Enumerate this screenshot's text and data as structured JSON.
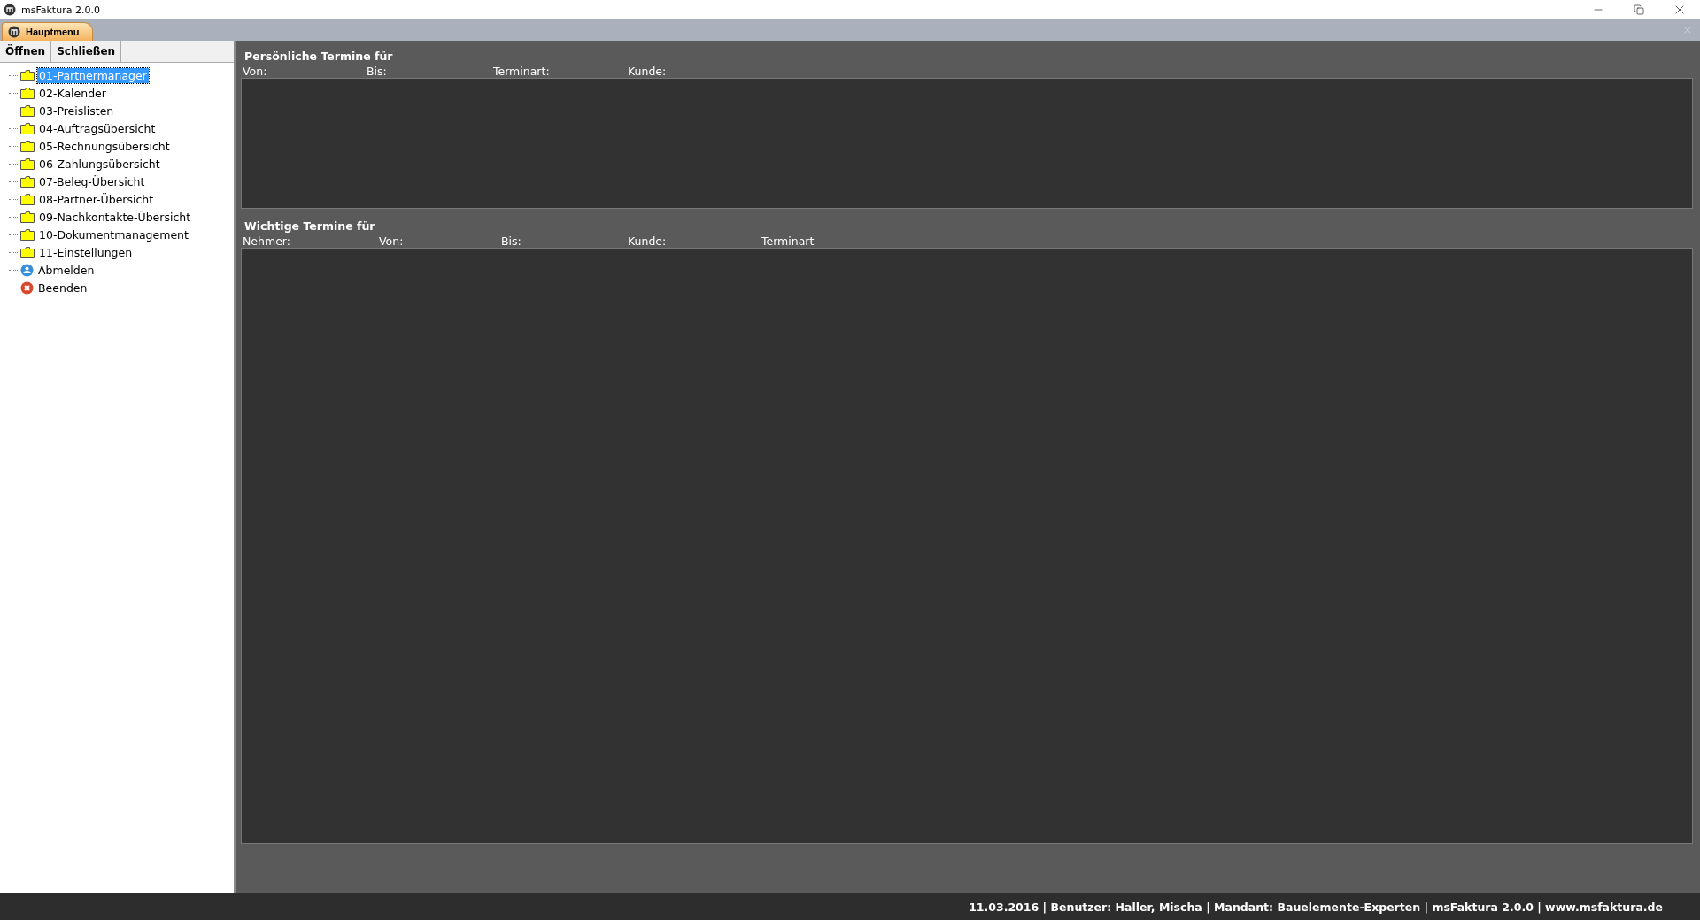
{
  "window": {
    "title": "msFaktura 2.0.0"
  },
  "tabs": [
    {
      "label": "Hauptmenu",
      "selected": true
    }
  ],
  "toolbar": [
    "Öffnen",
    "Schließen"
  ],
  "tree": [
    {
      "label": "01-Partnermanager",
      "kind": "folder",
      "selected": true
    },
    {
      "label": "02-Kalender",
      "kind": "folder",
      "selected": false
    },
    {
      "label": "03-Preislisten",
      "kind": "folder",
      "selected": false
    },
    {
      "label": "04-Auftragsübersicht",
      "kind": "folder",
      "selected": false
    },
    {
      "label": "05-Rechnungsübersicht",
      "kind": "folder",
      "selected": false
    },
    {
      "label": "06-Zahlungsübersicht",
      "kind": "folder",
      "selected": false
    },
    {
      "label": "07-Beleg-Übersicht",
      "kind": "folder",
      "selected": false
    },
    {
      "label": "08-Partner-Übersicht",
      "kind": "folder",
      "selected": false
    },
    {
      "label": "09-Nachkontakte-Übersicht",
      "kind": "folder",
      "selected": false
    },
    {
      "label": "10-Dokumentmanagement",
      "kind": "folder",
      "selected": false
    },
    {
      "label": "11-Einstellungen",
      "kind": "folder",
      "selected": false
    },
    {
      "label": "Abmelden",
      "kind": "logout",
      "selected": false
    },
    {
      "label": "Beenden",
      "kind": "exit",
      "selected": false
    }
  ],
  "sections": [
    {
      "title": "Persönliche Termine für",
      "columns": [
        "Von:",
        "Bis:",
        "Terminart:",
        "Kunde:"
      ],
      "kind": "compact"
    },
    {
      "title": "Wichtige Termine für",
      "columns": [
        "Nehmer:",
        "Von:",
        "Bis:",
        "Kunde:",
        "Terminart"
      ],
      "kind": "expanded"
    }
  ],
  "status_bar": "11.03.2016 | Benutzer: Haller, Mischa | Mandant: Bauelemente-Experten |  msFaktura 2.0.0 | www.msfaktura.de"
}
